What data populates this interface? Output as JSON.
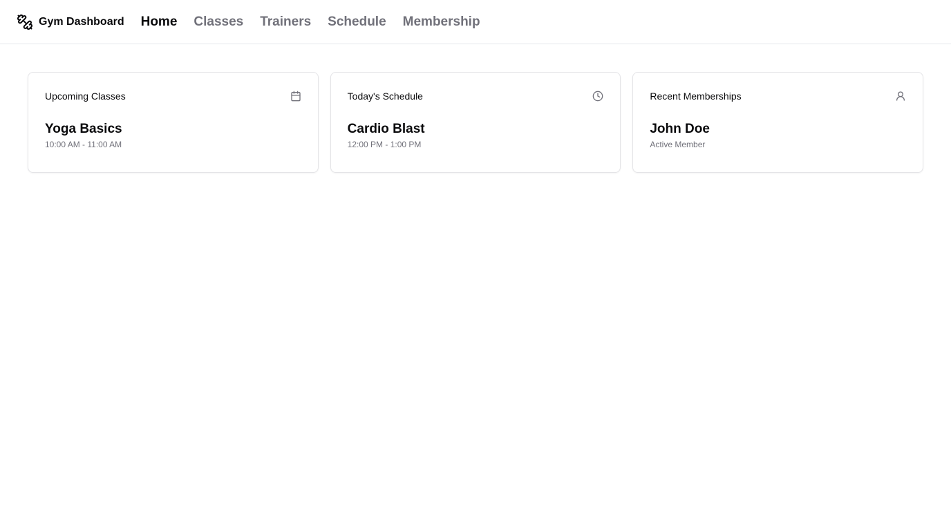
{
  "header": {
    "brand": "Gym Dashboard",
    "brand_icon": "dumbbell-icon",
    "nav": [
      {
        "label": "Home",
        "active": true
      },
      {
        "label": "Classes",
        "active": false
      },
      {
        "label": "Trainers",
        "active": false
      },
      {
        "label": "Schedule",
        "active": false
      },
      {
        "label": "Membership",
        "active": false
      }
    ]
  },
  "cards": [
    {
      "title": "Upcoming Classes",
      "icon": "calendar-icon",
      "main": "Yoga Basics",
      "sub": "10:00 AM - 11:00 AM"
    },
    {
      "title": "Today's Schedule",
      "icon": "clock-icon",
      "main": "Cardio Blast",
      "sub": "12:00 PM - 1:00 PM"
    },
    {
      "title": "Recent Memberships",
      "icon": "user-icon",
      "main": "John Doe",
      "sub": "Active Member"
    }
  ],
  "colors": {
    "text": "#09090b",
    "muted": "#71717a",
    "border": "#e4e4e7"
  }
}
